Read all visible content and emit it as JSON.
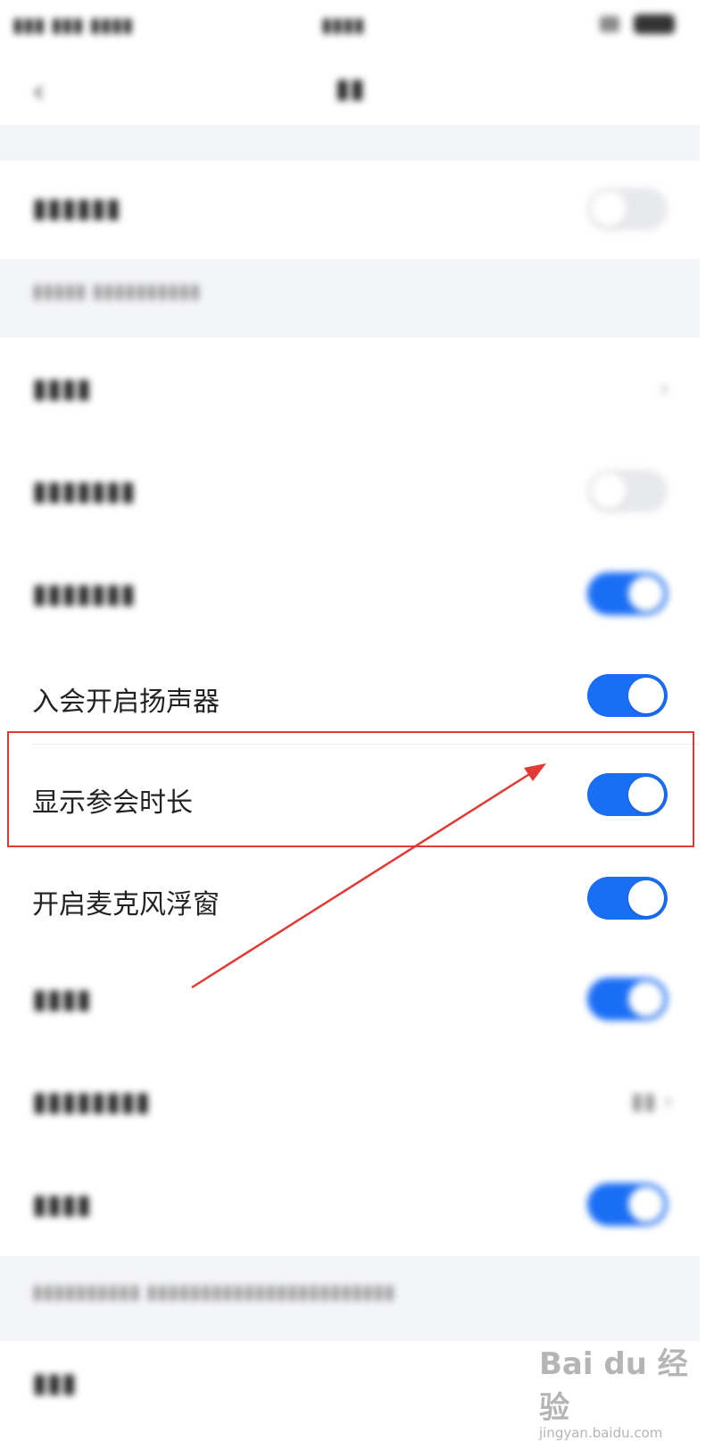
{
  "settings": {
    "speaker_on_join": {
      "label": "入会开启扬声器",
      "enabled": true
    },
    "show_meeting_duration": {
      "label": "显示参会时长",
      "enabled": true
    },
    "mic_floating_window": {
      "label": "开启麦克风浮窗",
      "enabled": true
    }
  },
  "watermark": {
    "brand": "Bai du 经验",
    "site": "jingyan.baidu.com"
  },
  "colors": {
    "toggle_on": "#1a6ef5",
    "toggle_off": "#e8e9ec",
    "highlight": "#e23a35"
  }
}
